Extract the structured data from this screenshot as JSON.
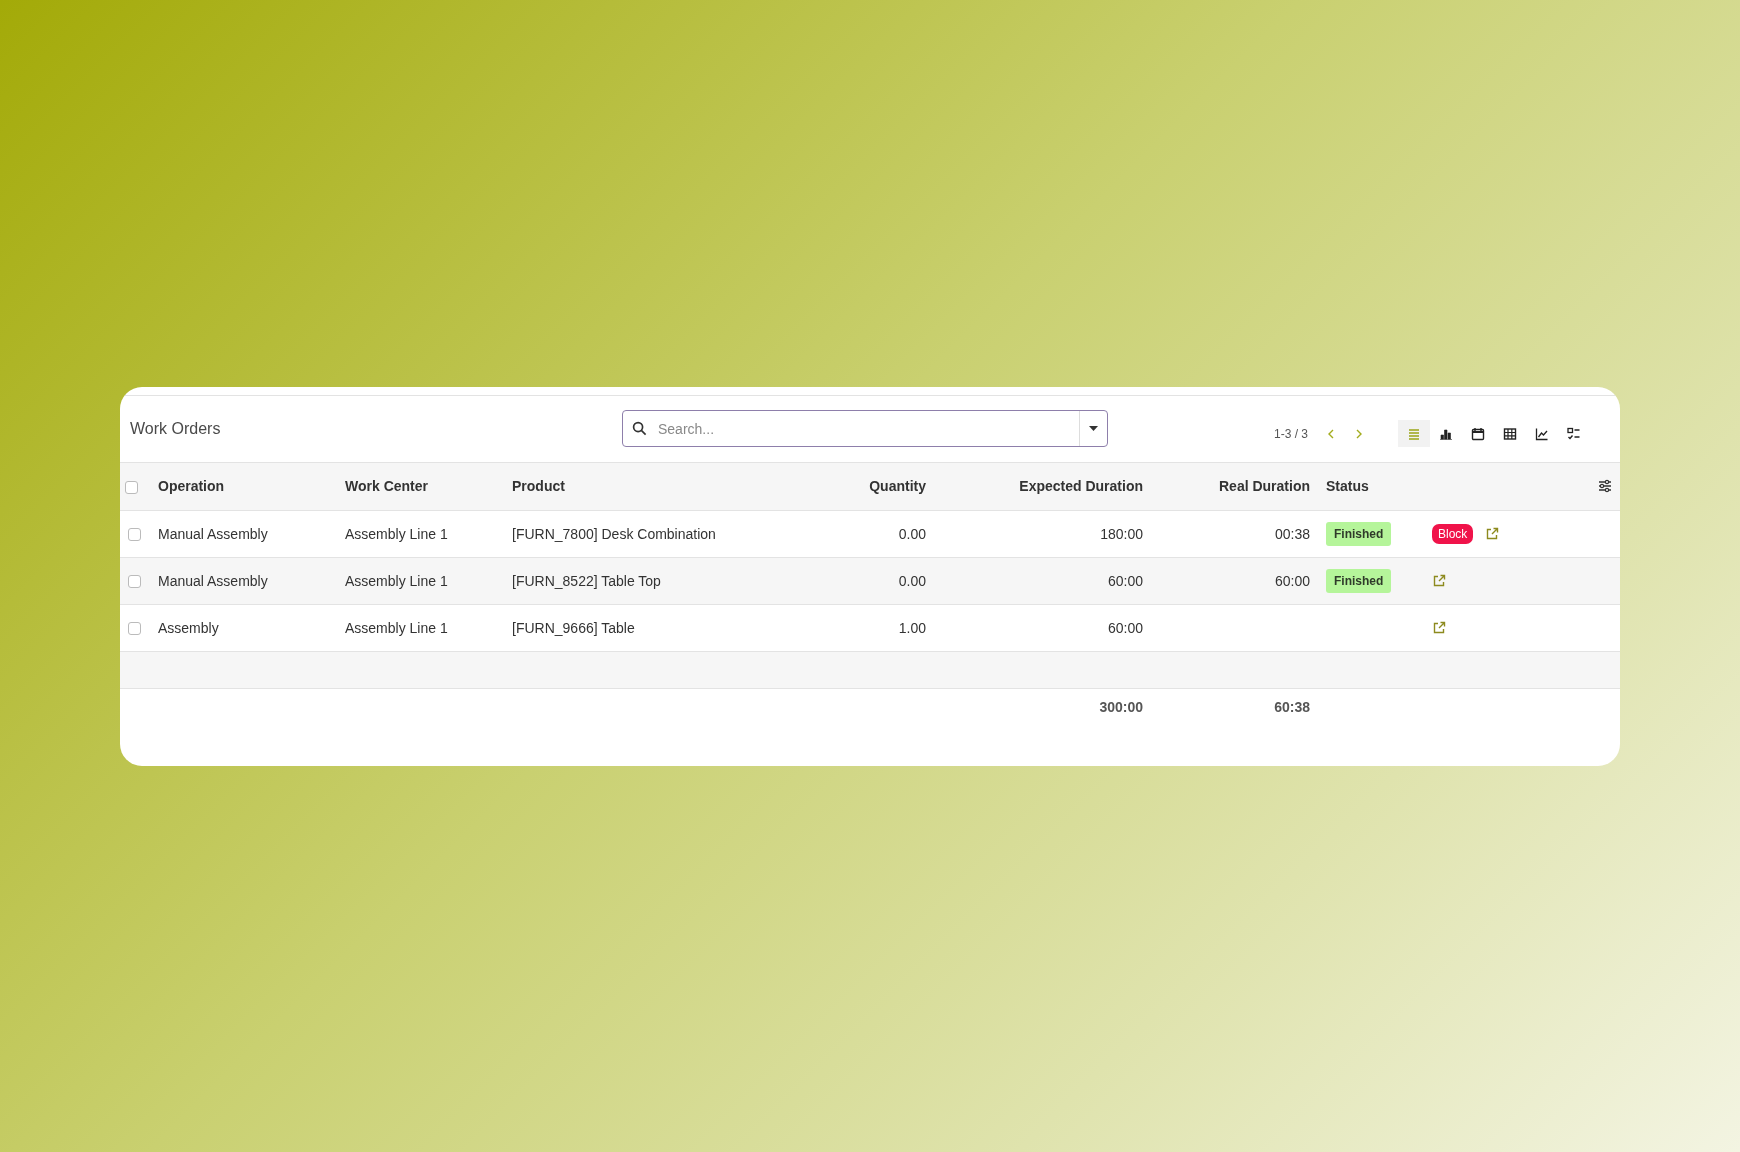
{
  "title": "Work Orders",
  "search": {
    "placeholder": "Search..."
  },
  "pager": {
    "range": "1-3 / 3"
  },
  "views": [
    {
      "kind": "list",
      "selected": true
    },
    {
      "kind": "graph",
      "selected": false
    },
    {
      "kind": "calendar",
      "selected": false
    },
    {
      "kind": "pivot",
      "selected": false
    },
    {
      "kind": "chart",
      "selected": false
    },
    {
      "kind": "activity",
      "selected": false
    }
  ],
  "select_all": {
    "checked": false
  },
  "columns": [
    {
      "label": "Operation",
      "kind": "text"
    },
    {
      "label": "Work Center",
      "kind": "text"
    },
    {
      "label": "Product",
      "kind": "text"
    },
    {
      "label": "Quantity",
      "kind": "number"
    },
    {
      "label": "Expected Duration",
      "kind": "number",
      "total": "300:00"
    },
    {
      "label": "Real Duration",
      "kind": "number",
      "total": "60:38"
    },
    {
      "label": "Status",
      "kind": "text"
    }
  ],
  "rows": [
    {
      "checked": false,
      "cells": [
        "Manual Assembly",
        "Assembly Line 1",
        "[FURN_7800] Desk Combination",
        "0.00",
        "180:00",
        "00:38"
      ],
      "status": "Finished",
      "actions": [
        {
          "kind": "badge",
          "label": "Block"
        },
        {
          "kind": "link"
        }
      ]
    },
    {
      "checked": false,
      "cells": [
        "Manual Assembly",
        "Assembly Line 1",
        "[FURN_8522] Table Top",
        "0.00",
        "60:00",
        "60:00"
      ],
      "status": "Finished",
      "actions": [
        {
          "kind": "link"
        }
      ]
    },
    {
      "checked": false,
      "cells": [
        "Assembly",
        "Assembly Line 1",
        "[FURN_9666] Table",
        "1.00",
        "60:00"
      ],
      "actions": [
        {
          "kind": "link"
        }
      ]
    }
  ]
}
